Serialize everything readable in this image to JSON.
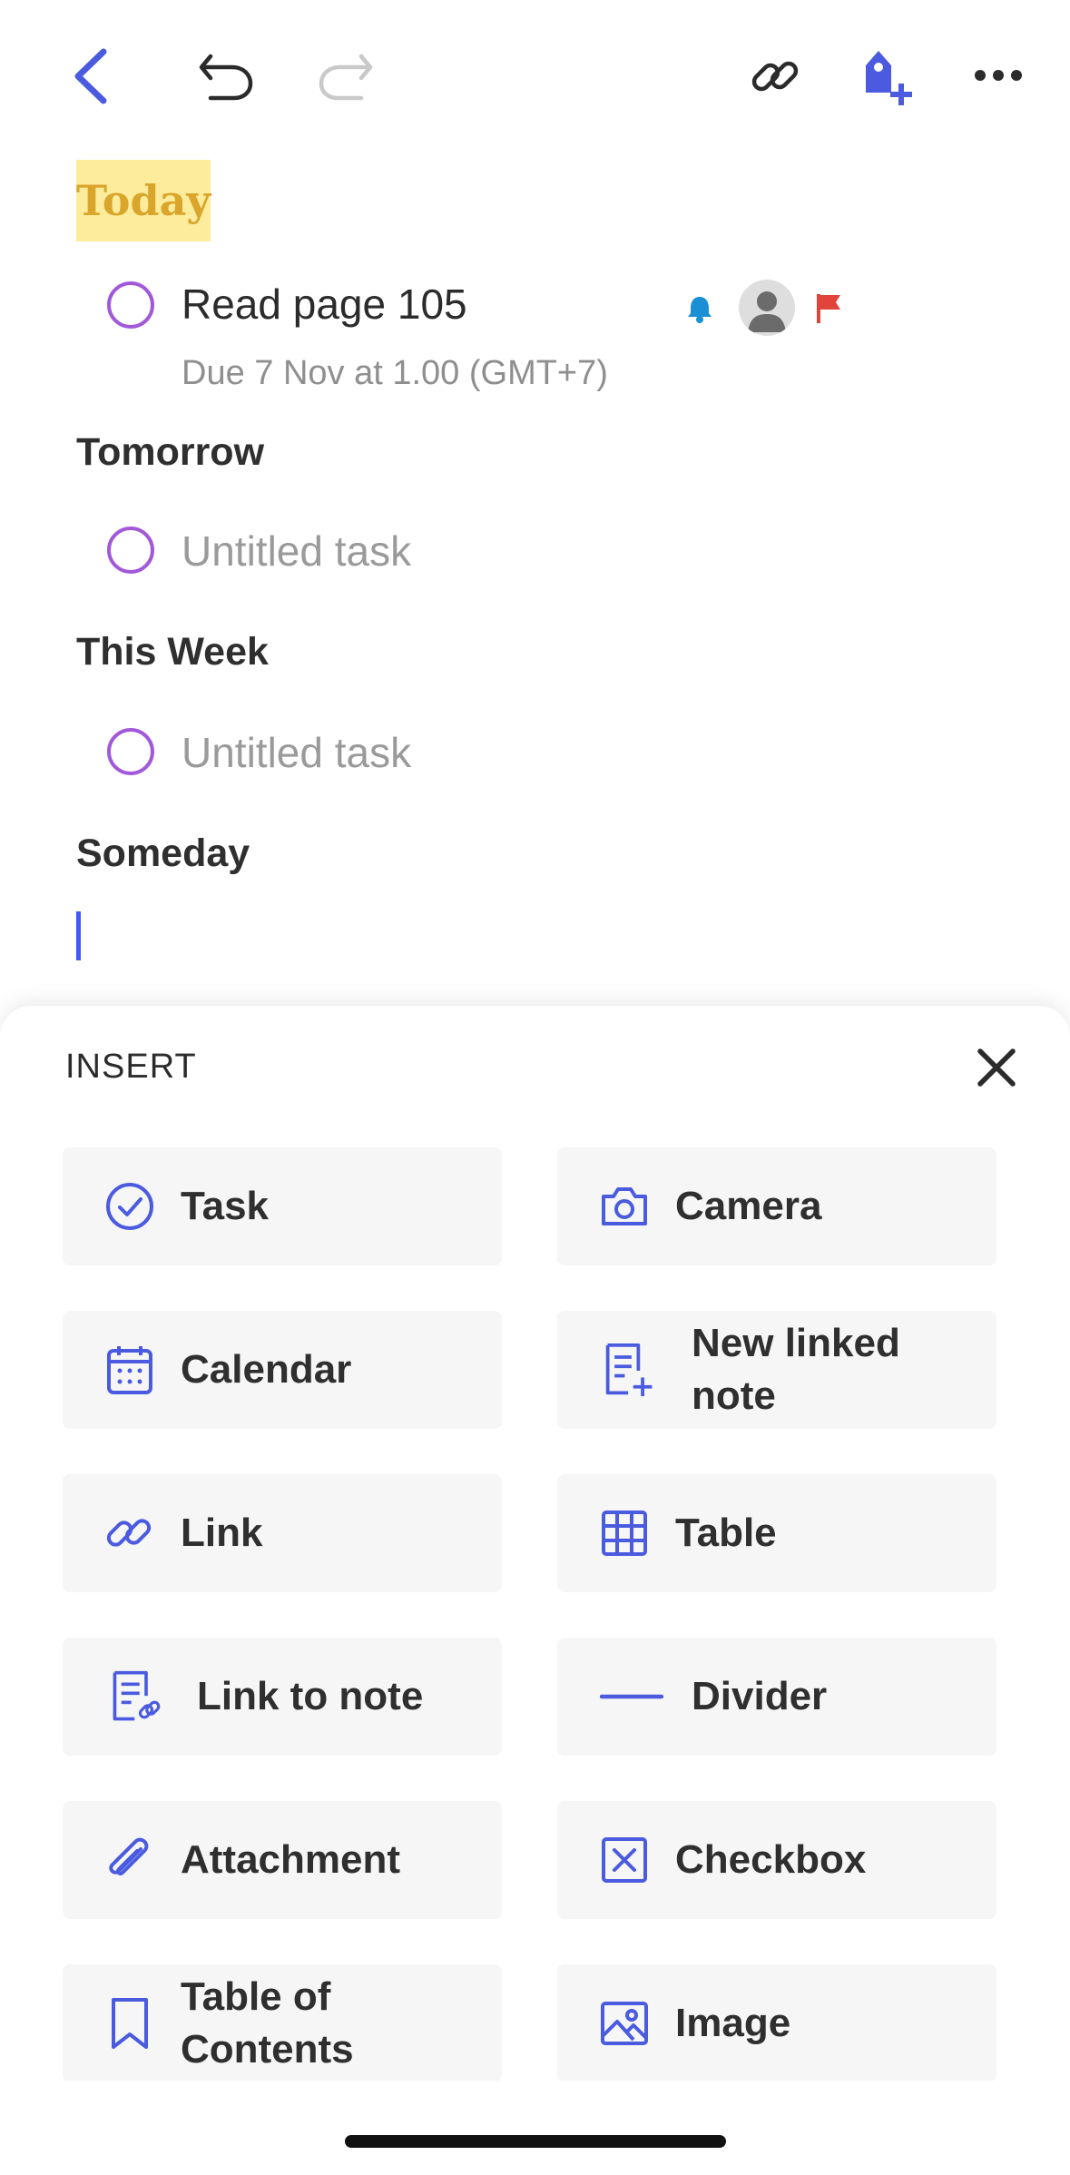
{
  "toolbar": {
    "icons": [
      "back-icon",
      "undo-icon",
      "redo-icon",
      "link-icon",
      "tag-add-icon",
      "more-icon"
    ]
  },
  "note": {
    "sections": [
      {
        "title": "Today"
      },
      {
        "title": "Tomorrow"
      },
      {
        "title": "This Week"
      },
      {
        "title": "Someday"
      }
    ],
    "today_task": {
      "title": "Read page 105",
      "due": "Due 7 Nov at 1.00 (GMT+7)"
    },
    "tomorrow_task": {
      "placeholder": "Untitled task"
    },
    "week_task": {
      "placeholder": "Untitled task"
    }
  },
  "insert_sheet": {
    "title": "INSERT",
    "items": [
      {
        "label": "Task",
        "icon": "task-check-icon"
      },
      {
        "label": "Camera",
        "icon": "camera-icon"
      },
      {
        "label": "Calendar",
        "icon": "calendar-icon"
      },
      {
        "label": "New linked note",
        "icon": "new-linked-note-icon"
      },
      {
        "label": "Link",
        "icon": "link-icon"
      },
      {
        "label": "Table",
        "icon": "table-icon"
      },
      {
        "label": "Link to note",
        "icon": "link-to-note-icon"
      },
      {
        "label": "Divider",
        "icon": "divider-icon"
      },
      {
        "label": "Attachment",
        "icon": "paperclip-icon"
      },
      {
        "label": "Checkbox",
        "icon": "checkbox-icon"
      },
      {
        "label": "Table of Contents",
        "icon": "bookmark-icon"
      },
      {
        "label": "Image",
        "icon": "image-icon"
      }
    ]
  },
  "colors": {
    "accent": "#4a5be0",
    "task_circle": "#a259d9",
    "highlight": "#fcec9c",
    "highlight_text": "#d9a52a",
    "reminder": "#1a8fd6",
    "flag": "#e0443b"
  }
}
